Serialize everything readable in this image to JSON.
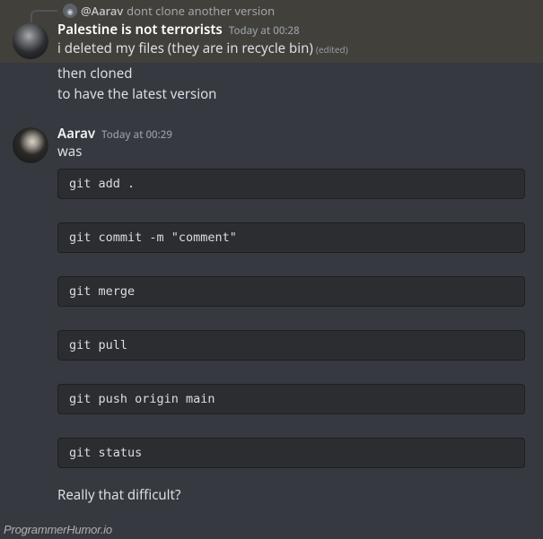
{
  "reply": {
    "mention": "@Aarav",
    "text": "dont clone another version"
  },
  "msg1": {
    "author": "Palestine is not terrorists",
    "timestamp": "Today at 00:28",
    "line1": "i deleted my files (they are in recycle bin)",
    "edited": "(edited)",
    "line2": "then cloned",
    "line3": "to have the latest version"
  },
  "msg2": {
    "author": "Aarav",
    "timestamp": "Today at 00:29",
    "line1": "was",
    "code1": "git add .",
    "code2": "git commit -m \"comment\"",
    "code3": "git merge",
    "code4": "git pull",
    "code5": "git push origin main",
    "code6": "git status",
    "line2": "Really that difficult?"
  },
  "watermark": "ProgrammerHumor.io"
}
